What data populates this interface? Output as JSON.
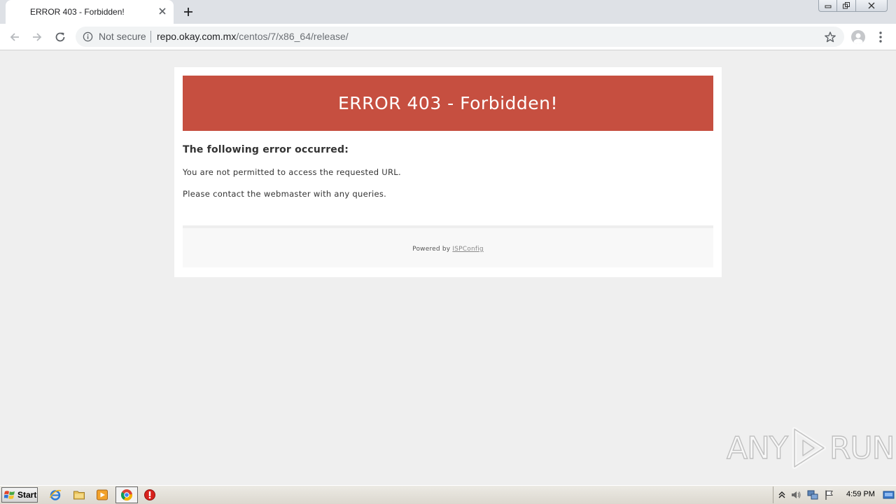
{
  "browser": {
    "tab_title": "ERROR 403 - Forbidden!",
    "security_label": "Not secure",
    "url_host": "repo.okay.com.mx",
    "url_path": "/centos/7/x86_64/release/"
  },
  "page": {
    "banner_title": "ERROR 403 - Forbidden!",
    "subheading": "The following error occurred:",
    "message_1": "You are not permitted to access the requested URL.",
    "message_2": "Please contact the webmaster with any queries.",
    "powered_by_prefix": "Powered by ",
    "powered_by_link": "ISPConfig"
  },
  "watermark": {
    "left": "ANY",
    "right": "RUN"
  },
  "taskbar": {
    "start_label": "Start",
    "clock": "4:59 PM"
  },
  "colors": {
    "banner": "#c64f40",
    "page_background": "#efefef",
    "tabstrip": "#dee1e6"
  },
  "icons": [
    "back-arrow-icon",
    "forward-arrow-icon",
    "reload-icon",
    "info-icon",
    "star-icon",
    "profile-icon",
    "kebab-menu-icon",
    "close-icon",
    "plus-icon",
    "internet-explorer-icon",
    "folder-icon",
    "media-player-icon",
    "chrome-icon",
    "stop-icon"
  ]
}
